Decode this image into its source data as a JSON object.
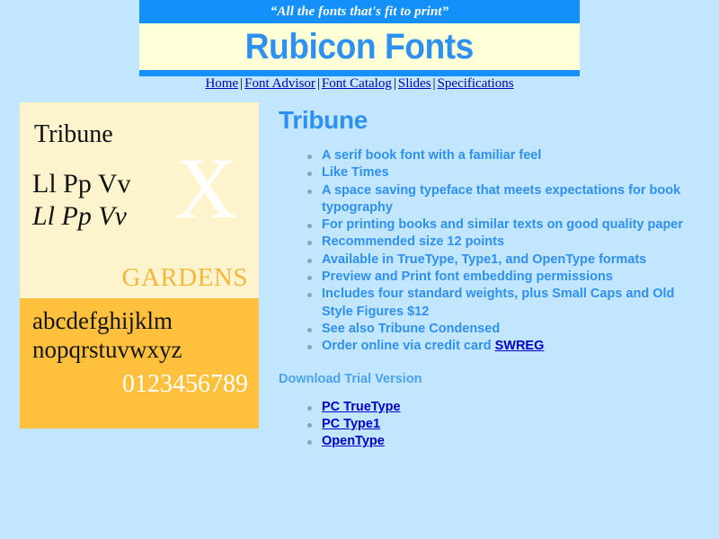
{
  "header": {
    "tagline": "“All the fonts that's fit to print”",
    "site_title": "Rubicon Fonts"
  },
  "nav": {
    "separator": "|",
    "items": [
      {
        "label": "Home"
      },
      {
        "label": "Font Advisor"
      },
      {
        "label": "Font Catalog"
      },
      {
        "label": "Slides"
      },
      {
        "label": "Specifications"
      }
    ]
  },
  "specimen": {
    "name": "Tribune",
    "roman_sample": "Ll Pp Vv",
    "italic_sample": "Ll Pp Vv",
    "big_char": "X",
    "display_word": "GARDENS",
    "alphabet_line1": "abcdefghijklm",
    "alphabet_line2": "nopqrstuvwxyz",
    "digits": "0123456789"
  },
  "main": {
    "heading": "Tribune",
    "features": [
      {
        "text": "A serif book font with a familiar feel"
      },
      {
        "text": "Like Times"
      },
      {
        "text": "A space saving typeface that meets expectations for book typography"
      },
      {
        "text": "For printing books and similar texts on good quality paper"
      },
      {
        "text": "Recommended size 12 points"
      },
      {
        "text": "Available in TrueType, Type1, and OpenType formats"
      },
      {
        "text": "Preview and Print font embedding permissions"
      },
      {
        "text": "Includes four standard weights, plus Small Caps and Old Style Figures $12"
      },
      {
        "text": " See also Tribune Condensed"
      },
      {
        "text": "Order online via credit card ",
        "link": "SWREG"
      }
    ],
    "download_heading": "Download Trial Version",
    "downloads": [
      {
        "label": "PC TrueType"
      },
      {
        "label": "PC Type1"
      },
      {
        "label": "OpenType"
      }
    ]
  },
  "colors": {
    "page_background": "#c2e6fd",
    "banner_blue": "#1490fb",
    "title_cream": "#ffffd8",
    "heading_blue": "#2e90f0",
    "link_blue": "#0000cc",
    "specimen_cream": "#fdf4cd",
    "specimen_orange": "#ffc13d",
    "display_word_orange": "#f5b73c",
    "bullet_gray": "#8fa3ae"
  }
}
